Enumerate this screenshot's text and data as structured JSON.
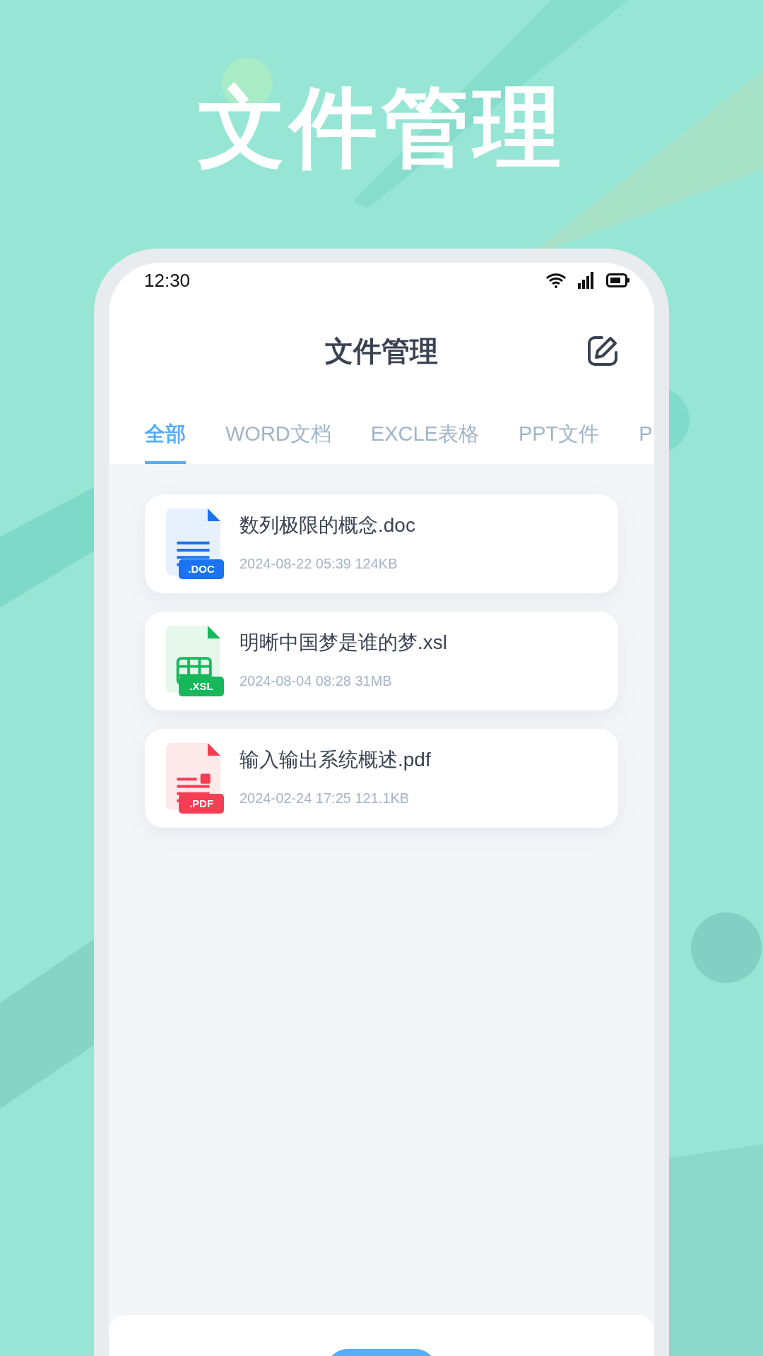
{
  "headline": "文件管理",
  "status_bar": {
    "time": "12:30"
  },
  "header": {
    "title": "文件管理"
  },
  "tabs": [
    {
      "label": "全部",
      "selected": true
    },
    {
      "label": "WORD文档",
      "selected": false
    },
    {
      "label": "EXCLE表格",
      "selected": false
    },
    {
      "label": "PPT文件",
      "selected": false
    },
    {
      "label": "P",
      "selected": false
    }
  ],
  "files": [
    {
      "kind": "doc",
      "badge": ".DOC",
      "name": "数列极限的概念.doc",
      "meta": "2024-08-22 05:39 124KB"
    },
    {
      "kind": "xsl",
      "badge": ".XSL",
      "name": "明晰中国梦是谁的梦.xsl",
      "meta": "2024-08-04 08:28 31MB"
    },
    {
      "kind": "pdf",
      "badge": ".PDF",
      "name": "输入输出系统概述.pdf",
      "meta": "2024-02-24 17:25 121.1KB"
    }
  ]
}
